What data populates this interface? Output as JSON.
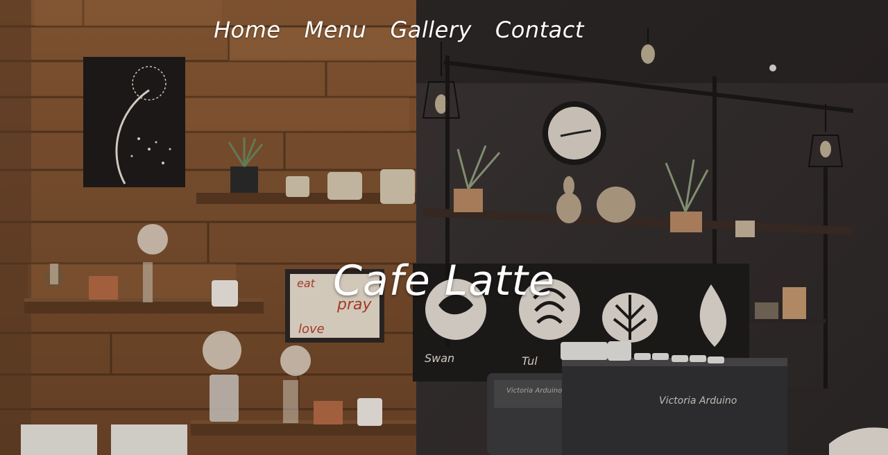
{
  "nav": {
    "items": [
      {
        "label": "Home"
      },
      {
        "label": "Menu"
      },
      {
        "label": "Gallery"
      },
      {
        "label": "Contact"
      }
    ]
  },
  "hero": {
    "title": "Cafe Latte",
    "board_labels": {
      "swan": "Swan",
      "tulip": "Tul"
    },
    "sign_words": [
      "eat",
      "pray",
      "love"
    ],
    "machine_brand": "Victoria Arduino"
  }
}
